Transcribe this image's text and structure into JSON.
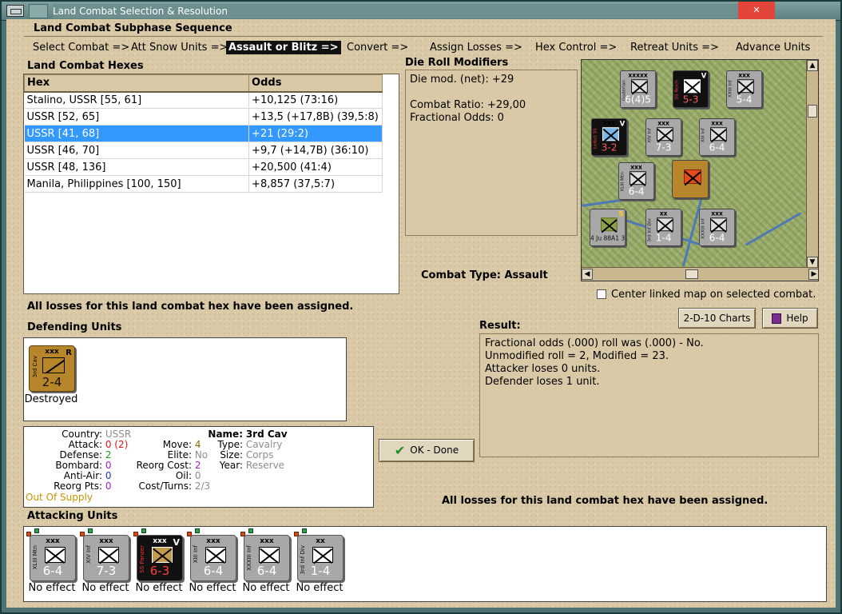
{
  "window": {
    "title": "Land Combat Selection & Resolution",
    "close_glyph": "✕"
  },
  "subphase": {
    "title": "Land Combat Subphase Sequence",
    "steps": [
      {
        "label": "Select Combat =>",
        "active": false
      },
      {
        "label": "Att Snow Units =>",
        "active": false
      },
      {
        "label": "Assault or Blitz =>",
        "active": true
      },
      {
        "label": "Convert =>",
        "active": false
      },
      {
        "label": "Assign Losses =>",
        "active": false
      },
      {
        "label": "Hex Control =>",
        "active": false
      },
      {
        "label": "Retreat Units =>",
        "active": false
      },
      {
        "label": "Advance Units",
        "active": false
      }
    ]
  },
  "hexes": {
    "section_label": "Land Combat Hexes",
    "columns": [
      "Hex",
      "Odds"
    ],
    "rows": [
      {
        "hex": "Stalino, USSR [55, 61]",
        "odds": "+10,125 (73:16)",
        "selected": false
      },
      {
        "hex": "USSR [52, 65]",
        "odds": "+13,5 (+17,8B) (39,5:8)",
        "selected": false
      },
      {
        "hex": "USSR [41, 68]",
        "odds": "+21 (29:2)",
        "selected": true
      },
      {
        "hex": "USSR [46, 70]",
        "odds": "+9,7 (+14,7B) (36:10)",
        "selected": false
      },
      {
        "hex": "USSR [48, 136]",
        "odds": "+20,500 (41:4)",
        "selected": false
      },
      {
        "hex": "Manila, Philippines [100, 150]",
        "odds": "+8,857 (37,5:7)",
        "selected": false
      }
    ]
  },
  "die_roll": {
    "section_label": "Die Roll Modifiers",
    "lines": [
      "Die mod. (net): +29",
      "",
      "Combat Ratio: +29,00",
      "Fractional Odds: 0"
    ]
  },
  "map": {
    "counters": [
      {
        "size": "xxxxx",
        "values": "6(4)5",
        "side": "Guderian",
        "tag": ""
      },
      {
        "size": "",
        "values": "5-3",
        "side": "SS Reich",
        "tag": "V"
      },
      {
        "size": "xxx",
        "values": "5-4",
        "side": "XXIII Inf",
        "tag": ""
      },
      {
        "size": "xxx",
        "values": "3-2",
        "side": "Leibst SS",
        "tag": "V"
      },
      {
        "size": "xxx",
        "values": "7-3",
        "side": "XIV Inf",
        "tag": ""
      },
      {
        "size": "xxx",
        "values": "6-4",
        "side": "XIII Inf",
        "tag": ""
      },
      {
        "size": "xxx",
        "values": "6-4",
        "side": "XLIII Mtn",
        "tag": ""
      },
      {
        "size": "xx",
        "values": "1-4",
        "side": "3rd Inf Div",
        "tag": ""
      },
      {
        "size": "xxx",
        "values": "6-4",
        "side": "XXXIII Inf",
        "tag": ""
      },
      {
        "size": "",
        "values": "4 Ju 88A1 3",
        "side": "",
        "tag": "5"
      }
    ]
  },
  "combat_type": {
    "label": "Combat Type:",
    "value": "Assault"
  },
  "center_map": {
    "label": "Center linked map on selected combat.",
    "checked": false
  },
  "buttons": {
    "charts": "2-D-10 Charts",
    "help": "Help",
    "ok": "OK - Done"
  },
  "losses_note": "All losses for this land combat hex have been assigned.",
  "defending": {
    "section_label": "Defending Units",
    "units": [
      {
        "size": "xxx",
        "tag": "R",
        "values": "2-4",
        "side": "3rd Cav",
        "status": "Destroyed"
      }
    ]
  },
  "result": {
    "section_label": "Result:",
    "lines": [
      "Fractional odds (.000) roll was (.000)  - No.",
      "Unmodified roll = 2, Modified = 23.",
      "Attacker loses 0 units.",
      "Defender loses 1 unit."
    ]
  },
  "unit_info": {
    "country_label": "Country:",
    "country": "USSR",
    "attack_label": "Attack:",
    "attack": "0 (2)",
    "defense_label": "Defense:",
    "defense": "2",
    "bombard_label": "Bombard:",
    "bombard": "0",
    "antiair_label": "Anti-Air:",
    "antiair": "0",
    "reorg_pts_label": "Reorg Pts:",
    "reorg_pts": "0",
    "supply": "Out Of Supply",
    "move_label": "Move:",
    "move": "4",
    "elite_label": "Elite:",
    "elite": "No",
    "reorg_cost_label": "Reorg Cost:",
    "reorg_cost": "2",
    "oil_label": "Oil:",
    "oil": "0",
    "cost_turns_label": "Cost/Turns:",
    "cost_turns": "2/3",
    "name_label": "Name:",
    "name": "3rd Cav",
    "type_label": "Type:",
    "type": "Cavalry",
    "size_label": "Size:",
    "size": "Corps",
    "year_label": "Year:",
    "year": "Reserve"
  },
  "attacking": {
    "section_label": "Attacking Units",
    "units": [
      {
        "size": "xxx",
        "values": "6-4",
        "side": "XLIII Mtn",
        "tag": "",
        "status": "No effect",
        "dark": false
      },
      {
        "size": "xxx",
        "values": "7-3",
        "side": "XIV Inf",
        "tag": "",
        "status": "No effect",
        "dark": false
      },
      {
        "size": "xxx",
        "values": "6-3",
        "side": "SS Panzer",
        "tag": "V",
        "status": "No effect",
        "dark": true
      },
      {
        "size": "xxx",
        "values": "6-4",
        "side": "XIII Inf",
        "tag": "",
        "status": "No effect",
        "dark": false
      },
      {
        "size": "xxx",
        "values": "6-4",
        "side": "XXXIII Inf",
        "tag": "",
        "status": "No effect",
        "dark": false
      },
      {
        "size": "xx",
        "values": "1-4",
        "side": "3rd Inf Div",
        "tag": "",
        "status": "No effect",
        "dark": false
      }
    ]
  },
  "colors": {
    "selected_row": "#3399ff",
    "panel_bg": "#d9c9a6",
    "axis_counter": "#a8a8a8",
    "ss_counter": "#111111",
    "soviet_counter": "#b7862a"
  }
}
